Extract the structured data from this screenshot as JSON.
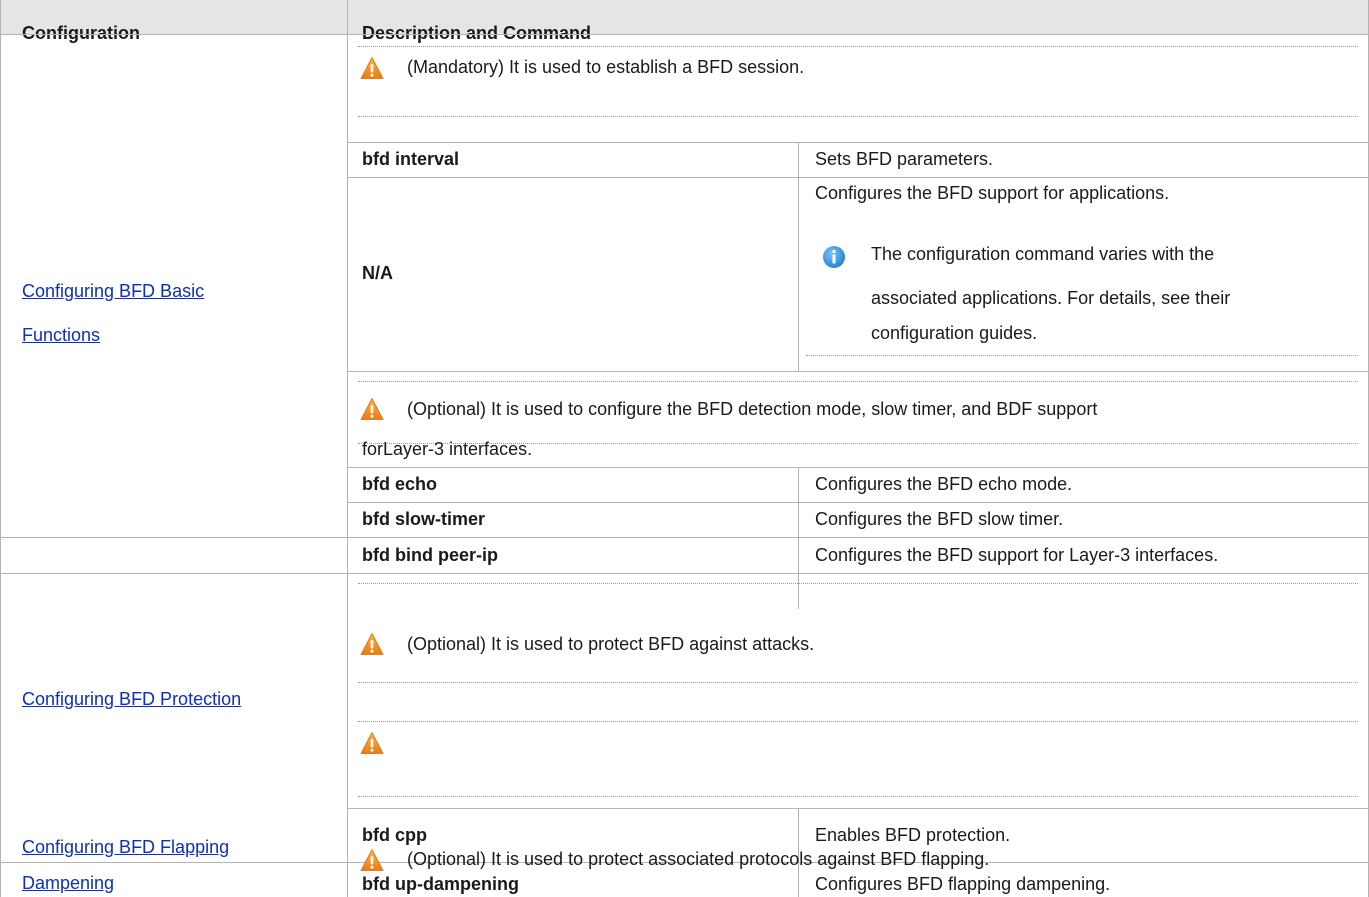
{
  "table": {
    "header": {
      "col1": "Configuration",
      "col2": "Description and Command"
    },
    "basic": {
      "link_line1": "Configuring BFD Basic ",
      "link_line2": "Functions",
      "mandatory_note": "(Mandatory) It is used to establish a BFD session.",
      "rows": [
        {
          "command": "bfd interval",
          "description": "Sets BFD parameters."
        },
        {
          "command": "N/A",
          "description": "Configures the BFD support for applications."
        }
      ],
      "info_note": {
        "line1": "The configuration command varies with the",
        "line2": "associated applications. For details, see their",
        "line3": "configuration guides."
      },
      "optional_note": {
        "line1": "(Optional) It is used to configure the BFD detection mode, slow timer, and BDF support",
        "line2": "forLayer-3 interfaces."
      },
      "optional_rows": [
        {
          "command": "bfd echo",
          "description": "Configures the BFD echo mode."
        },
        {
          "command": "bfd slow-timer",
          "description": "Configures the BFD slow timer."
        }
      ]
    },
    "bind_row": {
      "command": "bfd bind peer-ip",
      "description": "Configures the BFD support for Layer-3 interfaces."
    },
    "protection": {
      "link": "Configuring BFD Protection",
      "note": "(Optional) It is used to protect BFD against attacks.",
      "rows": [
        {
          "command": "bfd cpp",
          "description": "Enables BFD protection."
        }
      ]
    },
    "dampening": {
      "link_line1": "Configuring BFD Flapping ",
      "link_line2": "Dampening",
      "note": "(Optional) It is used to protect associated protocols against BFD flapping.",
      "rows": [
        {
          "command": "bfd up-dampening",
          "description": "Configures BFD flapping dampening."
        }
      ]
    }
  },
  "icons": {
    "warning": "warning-icon",
    "info": "info-icon"
  },
  "colors": {
    "header_bg": "#e5e5e5",
    "link": "#0b2fc4",
    "warning": "#f28c1e",
    "info": "#2f8fd8"
  }
}
